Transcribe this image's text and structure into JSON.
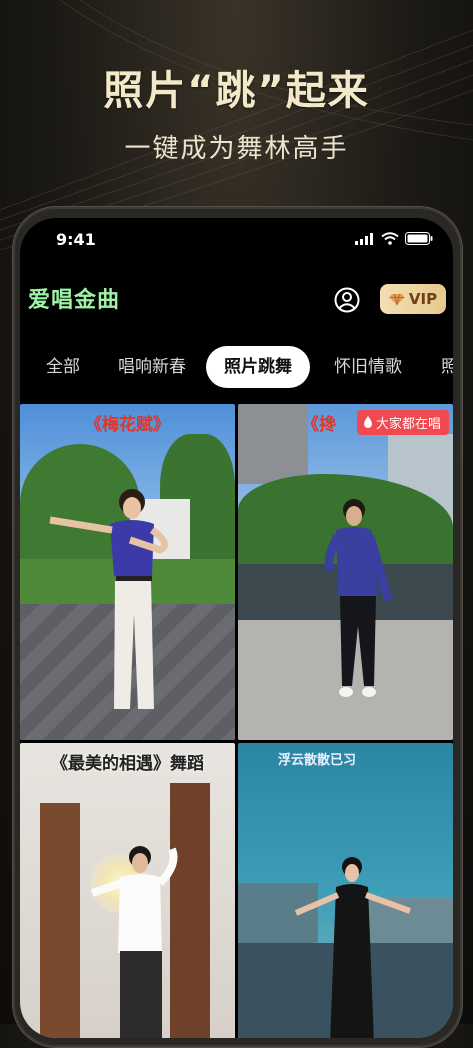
{
  "hero": {
    "title": "照片“跳”起来",
    "subtitle": "一键成为舞林高手"
  },
  "status_bar": {
    "time": "9:41"
  },
  "header": {
    "logo": "爱唱金曲",
    "vip_label": "VIP"
  },
  "tabs": [
    {
      "label": "全部"
    },
    {
      "label": "唱响新春"
    },
    {
      "label": "照片跳舞",
      "active": true
    },
    {
      "label": "怀旧情歌"
    },
    {
      "label": "照"
    }
  ],
  "cards": [
    {
      "title": "《梅花赋》",
      "title_color": "#e0362c"
    },
    {
      "title": "《搀",
      "title_color": "#e0362c",
      "badge": "大家都在唱"
    },
    {
      "title": "《最美的相遇》舞蹈",
      "title_color": "#222222"
    },
    {
      "title": "浮云散散已习",
      "title_color": "#e9f3ff"
    }
  ],
  "colors": {
    "accent_logo": "#9df2a6",
    "vip_gold": "#e8c98d",
    "badge_red": "#f0494f"
  }
}
